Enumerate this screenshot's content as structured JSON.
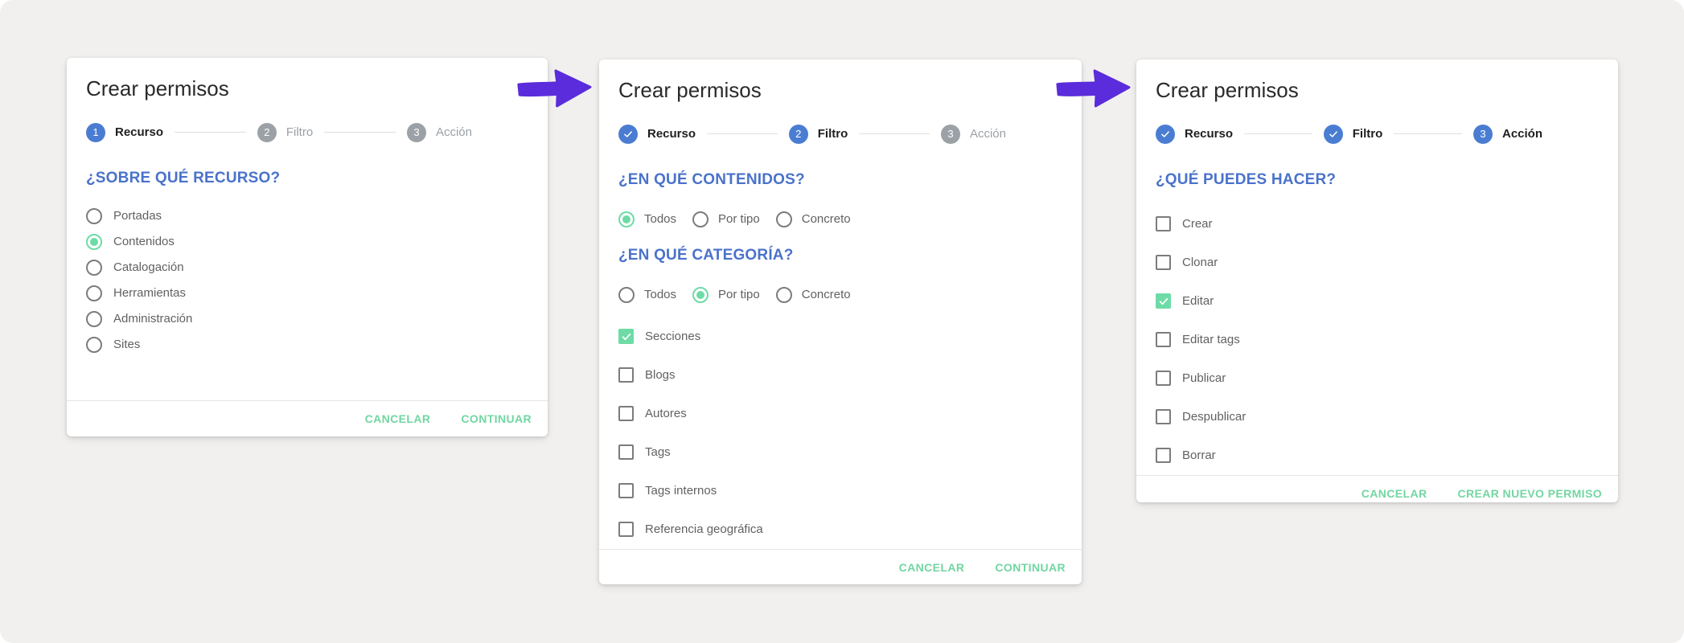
{
  "canvas": {
    "background": "#f1f0ee"
  },
  "colors": {
    "accent_blue": "#4a7dd2",
    "heading_blue": "#4a72cb",
    "accent_green": "#6edba7",
    "button_green": "#72d6a2",
    "arrow_purple": "#5b2cdb",
    "inactive_gray": "#9ba1a6"
  },
  "dialogs": [
    {
      "title": "Crear permisos",
      "steps": [
        {
          "number": "1",
          "label": "Recurso",
          "state": "active"
        },
        {
          "number": "2",
          "label": "Filtro",
          "state": "upcoming"
        },
        {
          "number": "3",
          "label": "Acción",
          "state": "upcoming"
        }
      ],
      "sections": [
        {
          "heading": "¿SOBRE QUÉ RECURSO?",
          "control": "radio",
          "options": [
            {
              "label": "Portadas",
              "selected": false
            },
            {
              "label": "Contenidos",
              "selected": true
            },
            {
              "label": "Catalogación",
              "selected": false
            },
            {
              "label": "Herramientas",
              "selected": false
            },
            {
              "label": "Administración",
              "selected": false
            },
            {
              "label": "Sites",
              "selected": false
            }
          ]
        }
      ],
      "footer": {
        "cancel_label": "CANCELAR",
        "confirm_label": "CONTINUAR"
      }
    },
    {
      "title": "Crear permisos",
      "steps": [
        {
          "icon": "check",
          "label": "Recurso",
          "state": "completed"
        },
        {
          "number": "2",
          "label": "Filtro",
          "state": "active"
        },
        {
          "number": "3",
          "label": "Acción",
          "state": "upcoming"
        }
      ],
      "sections": [
        {
          "heading": "¿EN QUÉ CONTENIDOS?",
          "control": "radio",
          "options": [
            {
              "label": "Todos",
              "selected": true
            },
            {
              "label": "Por tipo",
              "selected": false
            },
            {
              "label": "Concreto",
              "selected": false
            }
          ]
        },
        {
          "heading": "¿EN QUÉ CATEGORÍA?",
          "control": "radio",
          "options": [
            {
              "label": "Todos",
              "selected": false
            },
            {
              "label": "Por tipo",
              "selected": true
            },
            {
              "label": "Concreto",
              "selected": false
            }
          ]
        },
        {
          "control": "checkbox",
          "options": [
            {
              "label": "Secciones",
              "checked": true
            },
            {
              "label": "Blogs",
              "checked": false
            },
            {
              "label": "Autores",
              "checked": false
            },
            {
              "label": "Tags",
              "checked": false
            },
            {
              "label": "Tags internos",
              "checked": false
            },
            {
              "label": "Referencia geográfica",
              "checked": false
            }
          ]
        }
      ],
      "footer": {
        "cancel_label": "CANCELAR",
        "confirm_label": "CONTINUAR"
      }
    },
    {
      "title": "Crear permisos",
      "steps": [
        {
          "icon": "check",
          "label": "Recurso",
          "state": "completed"
        },
        {
          "icon": "check",
          "label": "Filtro",
          "state": "completed"
        },
        {
          "number": "3",
          "label": "Acción",
          "state": "active"
        }
      ],
      "sections": [
        {
          "heading": "¿QUÉ PUEDES HACER?",
          "control": "checkbox",
          "options": [
            {
              "label": "Crear",
              "checked": false
            },
            {
              "label": "Clonar",
              "checked": false
            },
            {
              "label": "Editar",
              "checked": true
            },
            {
              "label": "Editar tags",
              "checked": false
            },
            {
              "label": "Publicar",
              "checked": false
            },
            {
              "label": "Despublicar",
              "checked": false
            },
            {
              "label": "Borrar",
              "checked": false
            }
          ]
        }
      ],
      "footer": {
        "cancel_label": "CANCELAR",
        "confirm_label": "CREAR NUEVO PERMISO"
      }
    }
  ]
}
